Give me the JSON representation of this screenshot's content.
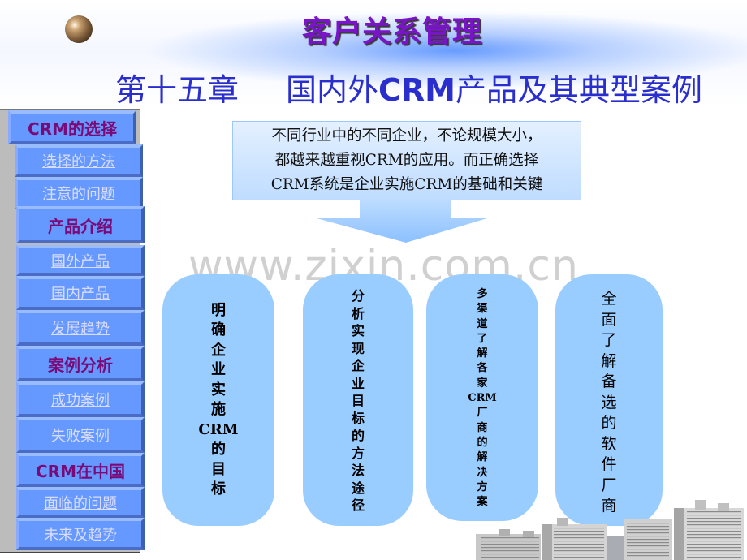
{
  "header": {
    "title": "客户关系管理",
    "chapter_number": "第十五章",
    "chapter_title_pre": "国内外",
    "chapter_title_crm": "CRM",
    "chapter_title_post": "产品及其典型案例"
  },
  "sidebar": {
    "items": [
      {
        "label": "CRM的选择",
        "type": "section"
      },
      {
        "label": "选择的方法",
        "type": "link"
      },
      {
        "label": "注意的问题",
        "type": "link"
      },
      {
        "label": "产品介绍",
        "type": "section"
      },
      {
        "label": "国外产品",
        "type": "link"
      },
      {
        "label": "国内产品",
        "type": "link"
      },
      {
        "label": "发展趋势",
        "type": "link"
      },
      {
        "label": "案例分析",
        "type": "section"
      },
      {
        "label": "成功案例",
        "type": "link"
      },
      {
        "label": "失败案例",
        "type": "link"
      },
      {
        "label": "CRM在中国",
        "type": "section"
      },
      {
        "label": "面临的问题",
        "type": "link"
      },
      {
        "label": "未来及趋势",
        "type": "link"
      }
    ]
  },
  "intro": {
    "lines": [
      "不同行业中的不同企业，不论规模大小，",
      "都越来越重视CRM的应用。而正确选择",
      "CRM系统是企业实施CRM的基础和关键"
    ]
  },
  "watermark": "www.zixin.com.cn",
  "cards": [
    {
      "chars": [
        "明",
        "确",
        "企",
        "业",
        "实",
        "施",
        "CRM",
        "的",
        "目",
        "标"
      ]
    },
    {
      "chars": [
        "分",
        "析",
        "实",
        "现",
        "企",
        "业",
        "目",
        "标",
        "的",
        "方",
        "法",
        "途",
        "径"
      ]
    },
    {
      "chars": [
        "多",
        "渠",
        "道",
        "了",
        "解",
        "各",
        "家",
        "CRM",
        "厂",
        "商",
        "的",
        "解",
        "决",
        "方",
        "案"
      ]
    },
    {
      "chars": [
        "全",
        "面",
        "了",
        "解",
        "备",
        "选",
        "的",
        "软",
        "件",
        "厂",
        "商"
      ]
    }
  ],
  "colors": {
    "title": "#7a14c8",
    "chapter": "#2a2ecc",
    "nav_button": "#6699ff",
    "nav_section_text": "#7a0a78",
    "nav_link_text": "#d8dcff",
    "card": "#99ccff"
  }
}
